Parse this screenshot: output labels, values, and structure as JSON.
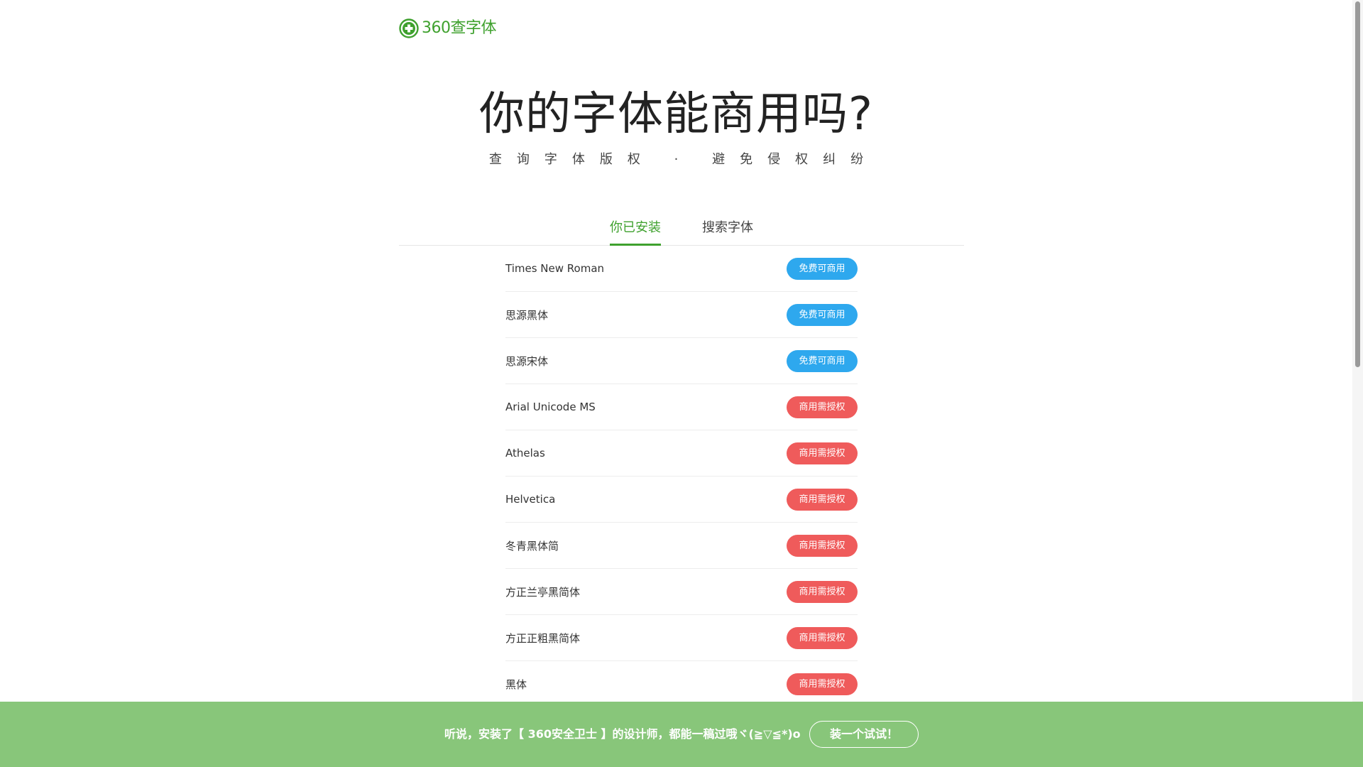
{
  "logo": {
    "text": "360查字体",
    "icon": "plus-circle-icon",
    "color": "#3fa12e"
  },
  "hero": {
    "title": "你的字体能商用吗?",
    "subtitle": "查询字体版权 · 避免侵权纠纷"
  },
  "tabs": [
    {
      "label": "你已安装",
      "active": true
    },
    {
      "label": "搜索字体",
      "active": false
    }
  ],
  "fonts": [
    {
      "name": "Times New Roman",
      "status": "免费可商用",
      "type": "free"
    },
    {
      "name": "思源黑体",
      "status": "免费可商用",
      "type": "free"
    },
    {
      "name": "思源宋体",
      "status": "免费可商用",
      "type": "free"
    },
    {
      "name": "Arial Unicode MS",
      "status": "商用需授权",
      "type": "paid"
    },
    {
      "name": "Athelas",
      "status": "商用需授权",
      "type": "paid"
    },
    {
      "name": "Helvetica",
      "status": "商用需授权",
      "type": "paid"
    },
    {
      "name": "冬青黑体简",
      "status": "商用需授权",
      "type": "paid"
    },
    {
      "name": "方正兰亭黑简体",
      "status": "商用需授权",
      "type": "paid"
    },
    {
      "name": "方正正粗黑简体",
      "status": "商用需授权",
      "type": "paid"
    },
    {
      "name": "黑体",
      "status": "商用需授权",
      "type": "paid"
    }
  ],
  "promo": {
    "text": "听说，安装了【 360安全卫士 】的设计师，都能一稿过哦ヾ(≧▽≦*)o",
    "button_label": "装一个试试！"
  },
  "colors": {
    "brand_green": "#3fa12e",
    "free_badge": "#2ea8ee",
    "paid_badge": "#ef5b5b",
    "promo_bg": "#88c67a"
  }
}
